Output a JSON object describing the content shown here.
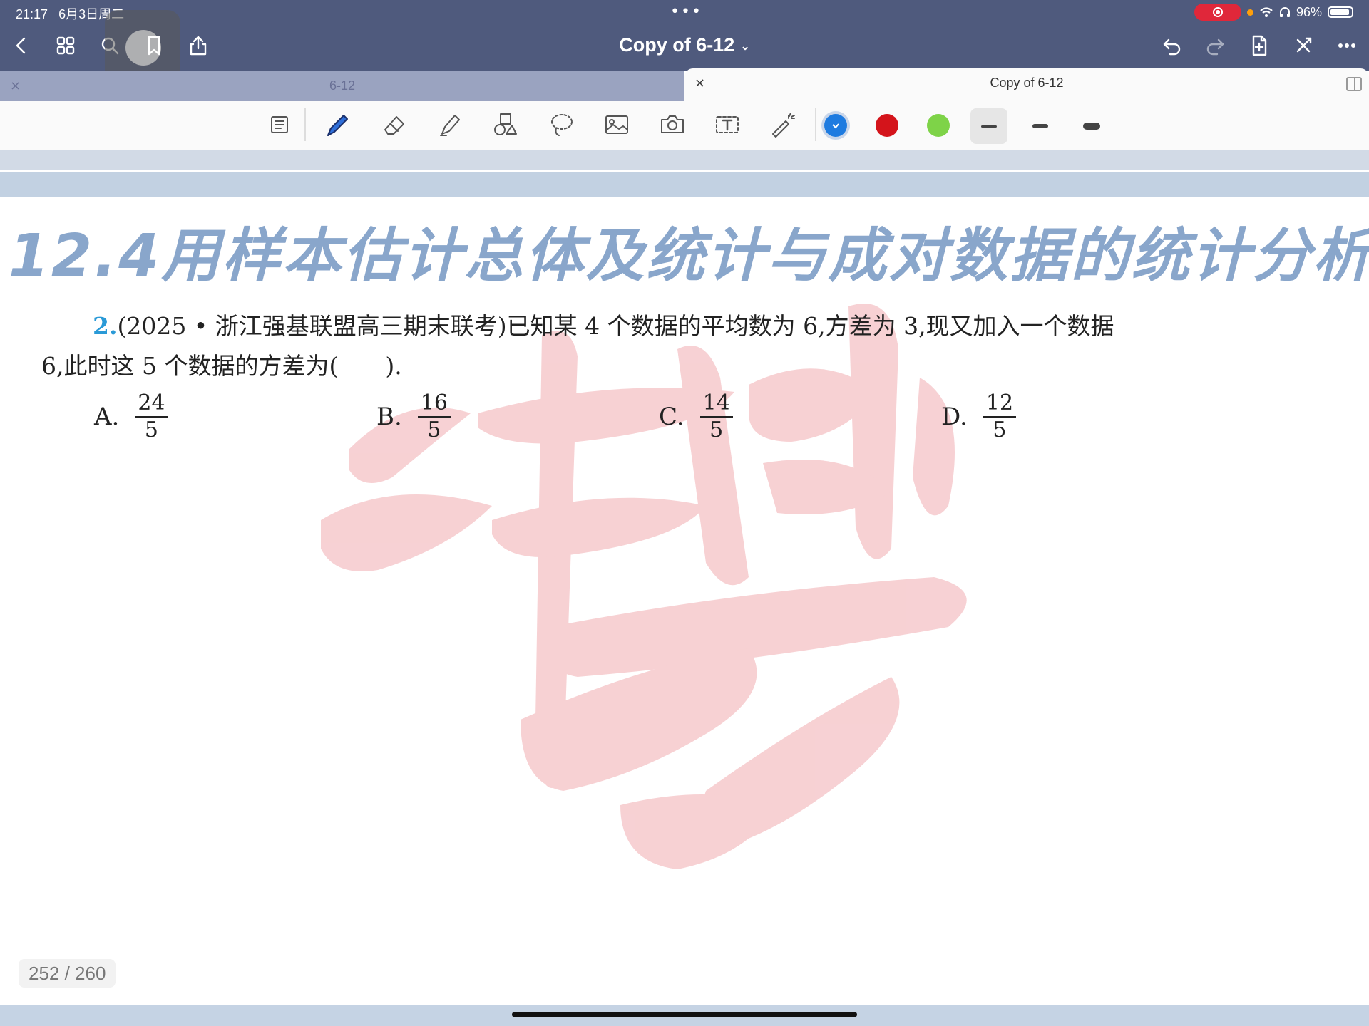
{
  "status_bar": {
    "time": "21:17",
    "date": "6月3日周二",
    "battery": "96%"
  },
  "nav": {
    "title": "Copy of 6-12"
  },
  "tabs": [
    {
      "label": "6-12",
      "active": false
    },
    {
      "label": "Copy of 6-12",
      "active": true
    }
  ],
  "toolbar": {
    "colors": [
      "#1e7be0",
      "#d4141b",
      "#7ed348"
    ],
    "selected_color": "#1e7be0",
    "tools": [
      "scan-icon",
      "pen-icon",
      "eraser-icon",
      "highlighter-icon",
      "shapes-icon",
      "lasso-icon",
      "image-icon",
      "camera-icon",
      "text-box-icon",
      "laser-pointer-icon"
    ]
  },
  "page": {
    "heading": "12.4用样本估计总体及统计与成对数据的统计分析",
    "question": {
      "number": "2.",
      "line1": "(2025 • 浙江强基联盟高三期末联考)已知某 4 个数据的平均数为 6,方差为 3,现又加入一个数据",
      "line2": "6,此时这 5 个数据的方差为(　　).",
      "options": [
        {
          "label": "A.",
          "num": "24",
          "den": "5"
        },
        {
          "label": "B.",
          "num": "16",
          "den": "5"
        },
        {
          "label": "C.",
          "num": "14",
          "den": "5"
        },
        {
          "label": "D.",
          "num": "12",
          "den": "5"
        }
      ]
    }
  },
  "page_indicator": "252 / 260"
}
